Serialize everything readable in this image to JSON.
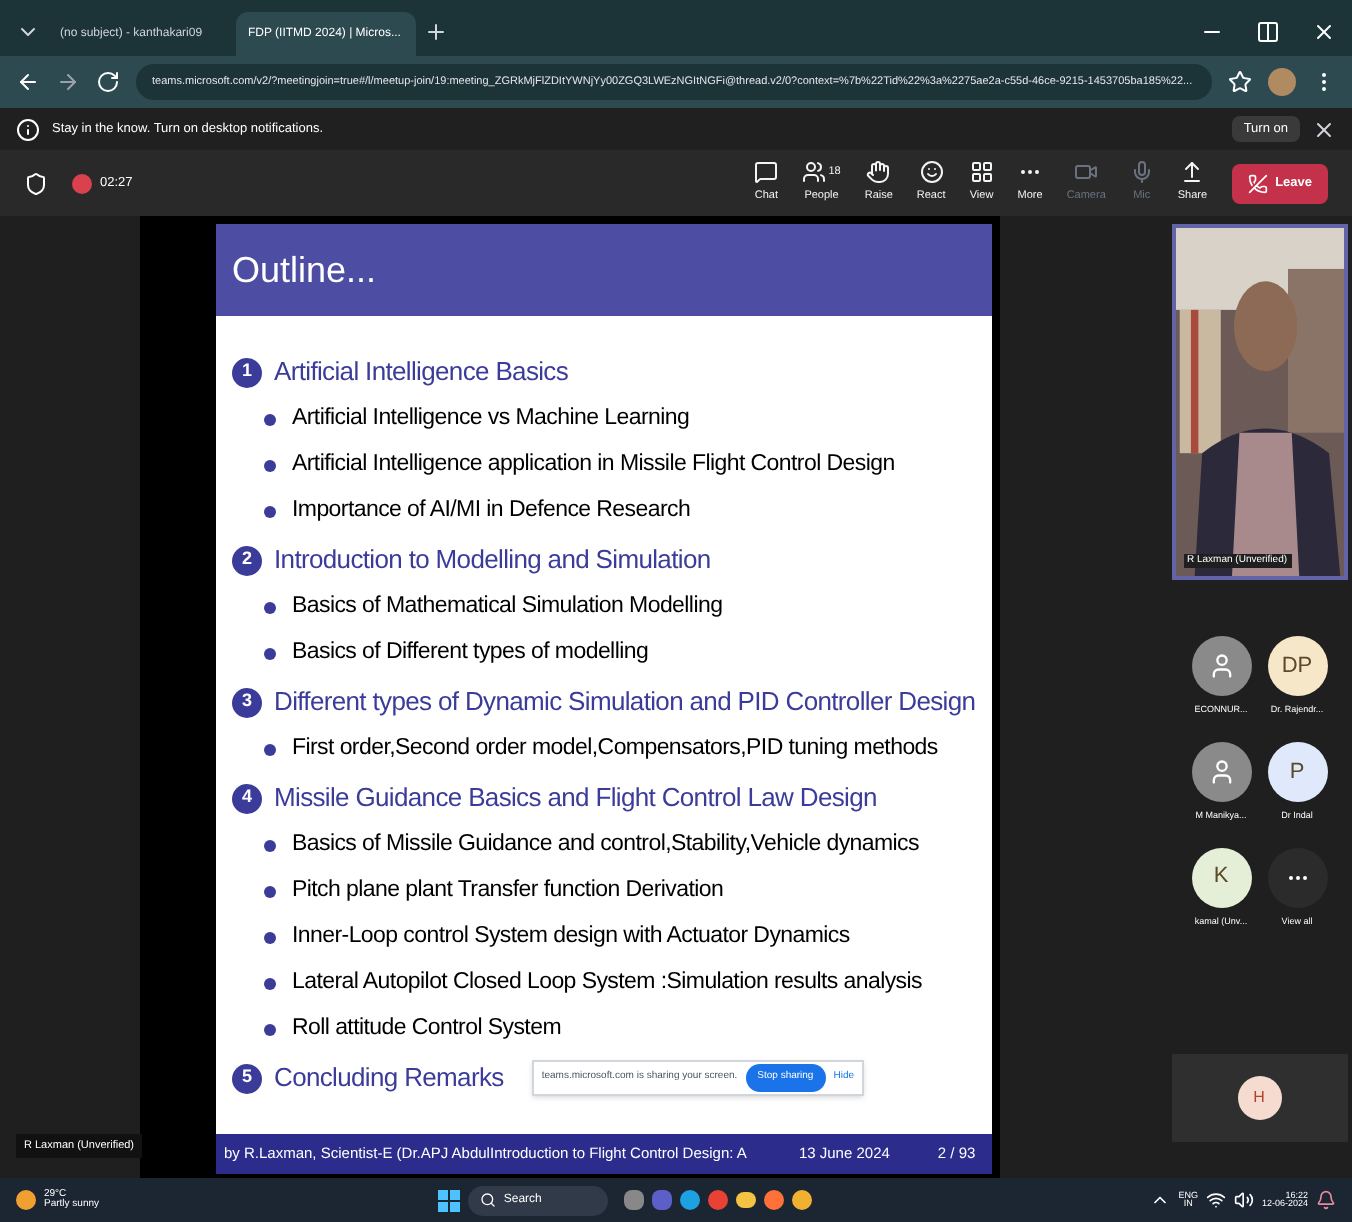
{
  "browser": {
    "tabs": [
      {
        "title": "(no subject) - kanthakari09",
        "selected": false
      },
      {
        "title": "FDP (IITMD 2024) | Micros...",
        "selected": true
      }
    ],
    "url": "teams.microsoft.com/v2/?meetingjoin=true#/l/meetup-join/19:meeting_ZGRkMjFlZDItYWNjYy00ZGQ3LWEzNGItNGFi@thread.v2/0?context=%7b%22Tid%22%3a%2275ae2a-c55d-46ce-9215-1453705ba185%22...",
    "notification": {
      "text": "Stay in the know. Turn on desktop notifications.",
      "button": "Turn on"
    }
  },
  "meeting": {
    "timer": "02:27",
    "toolbar": [
      {
        "kind": "chat",
        "label": "Chat",
        "disabled": false
      },
      {
        "kind": "people",
        "label": "People",
        "count": "18",
        "disabled": false
      },
      {
        "kind": "raise",
        "label": "Raise",
        "disabled": false
      },
      {
        "kind": "react",
        "label": "React",
        "disabled": false
      },
      {
        "kind": "view",
        "label": "View",
        "disabled": false
      },
      {
        "kind": "more",
        "label": "More",
        "disabled": false
      },
      {
        "kind": "camera",
        "label": "Camera",
        "disabled": true
      },
      {
        "kind": "mic",
        "label": "Mic",
        "disabled": true
      },
      {
        "kind": "share",
        "label": "Share",
        "disabled": false
      }
    ],
    "leave": "Leave"
  },
  "slide": {
    "title": "Outline...",
    "sections": [
      {
        "number": "1",
        "title": "Artificial Intelligence Basics",
        "bullets": [
          "Artificial Intelligence vs Machine Learning",
          "Artificial Intelligence application in Missile Flight Control Design",
          "Importance of AI/MI in Defence Research"
        ]
      },
      {
        "number": "2",
        "title": "Introduction to Modelling and Simulation",
        "bullets": [
          "Basics of Mathematical  Simulation Modelling",
          "Basics of Different types of modelling"
        ]
      },
      {
        "number": "3",
        "title": "Different types of Dynamic Simulation and PID Controller Design",
        "bullets": [
          "First order,Second order model,Compensators,PID tuning methods"
        ]
      },
      {
        "number": "4",
        "title": "Missile Guidance Basics and Flight Control Law Design",
        "bullets": [
          "Basics of Missile Guidance and control,Stability,Vehicle dynamics",
          "Pitch plane plant Transfer function Derivation",
          "Inner-Loop control System design with Actuator Dynamics",
          "Lateral Autopilot Closed Loop System :Simulation results analysis",
          "Roll attitude Control System"
        ]
      },
      {
        "number": "5",
        "title": "Concluding Remarks"
      }
    ],
    "share_banner": {
      "text": "teams.microsoft.com is sharing your screen.",
      "stop": "Stop sharing",
      "hide": "Hide"
    },
    "footer": {
      "author": "by  R.Laxman, Scientist-E (Dr.APJ Abdul",
      "title": "Introduction to Flight Control Design: A",
      "date": "13 June 2024",
      "page": "2 / 93"
    }
  },
  "presenter_label": "R Laxman (Unverified)",
  "participants": {
    "video": {
      "name": "R Laxman (Unverified)"
    },
    "tiles": [
      {
        "kind": "icon",
        "name": "ECONNUR...",
        "color": "#8a8a8a"
      },
      {
        "kind": "initials",
        "initials": "DP",
        "name": "Dr. Rajendr...",
        "color": "#f6e7c8"
      },
      {
        "kind": "icon",
        "name": "M Manikya...",
        "color": "#8a8a8a"
      },
      {
        "kind": "initials",
        "initials": "P",
        "name": "Dr Indal",
        "color": "#dfe9fb"
      },
      {
        "kind": "initials",
        "initials": "K",
        "name": "kamal (Unv...",
        "color": "#e5efd8"
      },
      {
        "kind": "more",
        "name": "View all",
        "color": "#2b2b2b"
      }
    ],
    "self_initials": "H"
  },
  "taskbar": {
    "temp": "29°C",
    "weather": "Partly sunny",
    "search": "Search",
    "lang": "ENG",
    "region": "IN",
    "time": "16:22",
    "date": "12-06-2024"
  }
}
